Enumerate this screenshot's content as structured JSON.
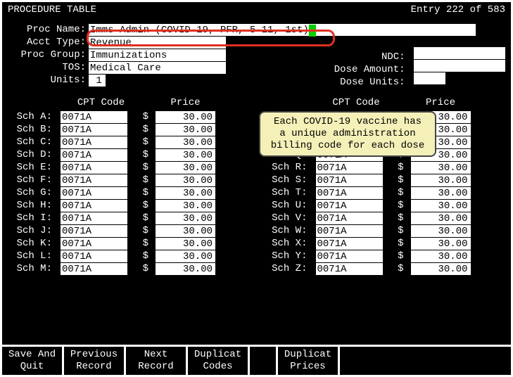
{
  "header": {
    "title": "PROCEDURE TABLE",
    "entry": "Entry 222 of 583"
  },
  "form": {
    "proc_name_label": "Proc Name:",
    "proc_name_value": "Imms Admin (COVID-19, PFR, 5-11, 1st)",
    "acct_type_label": "Acct Type:",
    "acct_type_value": "Revenue",
    "proc_group_label": "Proc Group:",
    "proc_group_value": "Immunizations",
    "tos_label": "TOS:",
    "tos_value": "Medical Care",
    "units_label": "Units:",
    "units_value": " 1",
    "ndc_label": "NDC:",
    "ndc_value": "",
    "dose_amount_label": "Dose Amount:",
    "dose_amount_value": "",
    "dose_units_label": "Dose Units:",
    "dose_units_value": ""
  },
  "sched_headers": {
    "cpt": "CPT Code",
    "price": "Price"
  },
  "left_rows": [
    {
      "label": "Sch A:",
      "code": "0071A",
      "price": "30.00"
    },
    {
      "label": "Sch B:",
      "code": "0071A",
      "price": "30.00"
    },
    {
      "label": "Sch C:",
      "code": "0071A",
      "price": "30.00"
    },
    {
      "label": "Sch D:",
      "code": "0071A",
      "price": "30.00"
    },
    {
      "label": "Sch E:",
      "code": "0071A",
      "price": "30.00"
    },
    {
      "label": "Sch F:",
      "code": "0071A",
      "price": "30.00"
    },
    {
      "label": "Sch G:",
      "code": "0071A",
      "price": "30.00"
    },
    {
      "label": "Sch H:",
      "code": "0071A",
      "price": "30.00"
    },
    {
      "label": "Sch I:",
      "code": "0071A",
      "price": "30.00"
    },
    {
      "label": "Sch J:",
      "code": "0071A",
      "price": "30.00"
    },
    {
      "label": "Sch K:",
      "code": "0071A",
      "price": "30.00"
    },
    {
      "label": "Sch L:",
      "code": "0071A",
      "price": "30.00"
    },
    {
      "label": "Sch M:",
      "code": "0071A",
      "price": "30.00"
    }
  ],
  "right_rows": [
    {
      "label": "",
      "code": "",
      "price": "30.00"
    },
    {
      "label": "",
      "code": "",
      "price": "30.00"
    },
    {
      "label": "",
      "code": "",
      "price": "30.00"
    },
    {
      "label": "Sch Q:",
      "code": "0071A",
      "price": "30.00"
    },
    {
      "label": "Sch R:",
      "code": "0071A",
      "price": "30.00"
    },
    {
      "label": "Sch S:",
      "code": "0071A",
      "price": "30.00"
    },
    {
      "label": "Sch T:",
      "code": "0071A",
      "price": "30.00"
    },
    {
      "label": "Sch U:",
      "code": "0071A",
      "price": "30.00"
    },
    {
      "label": "Sch V:",
      "code": "0071A",
      "price": "30.00"
    },
    {
      "label": "Sch W:",
      "code": "0071A",
      "price": "30.00"
    },
    {
      "label": "Sch X:",
      "code": "0071A",
      "price": "30.00"
    },
    {
      "label": "Sch Y:",
      "code": "0071A",
      "price": "30.00"
    },
    {
      "label": "Sch Z:",
      "code": "0071A",
      "price": "30.00"
    }
  ],
  "callout": {
    "line1": "Each COVID-19 vaccine has",
    "line2": "a unique administration",
    "line3": "billing code for each dose"
  },
  "buttons": {
    "b1a": "Save And",
    "b1b": "Quit",
    "b2a": "Previous",
    "b2b": "Record",
    "b3a": "Next",
    "b3b": "Record",
    "b4a": "Duplicat",
    "b4b": "Codes",
    "b5a": "Duplicat",
    "b5b": "Prices"
  }
}
